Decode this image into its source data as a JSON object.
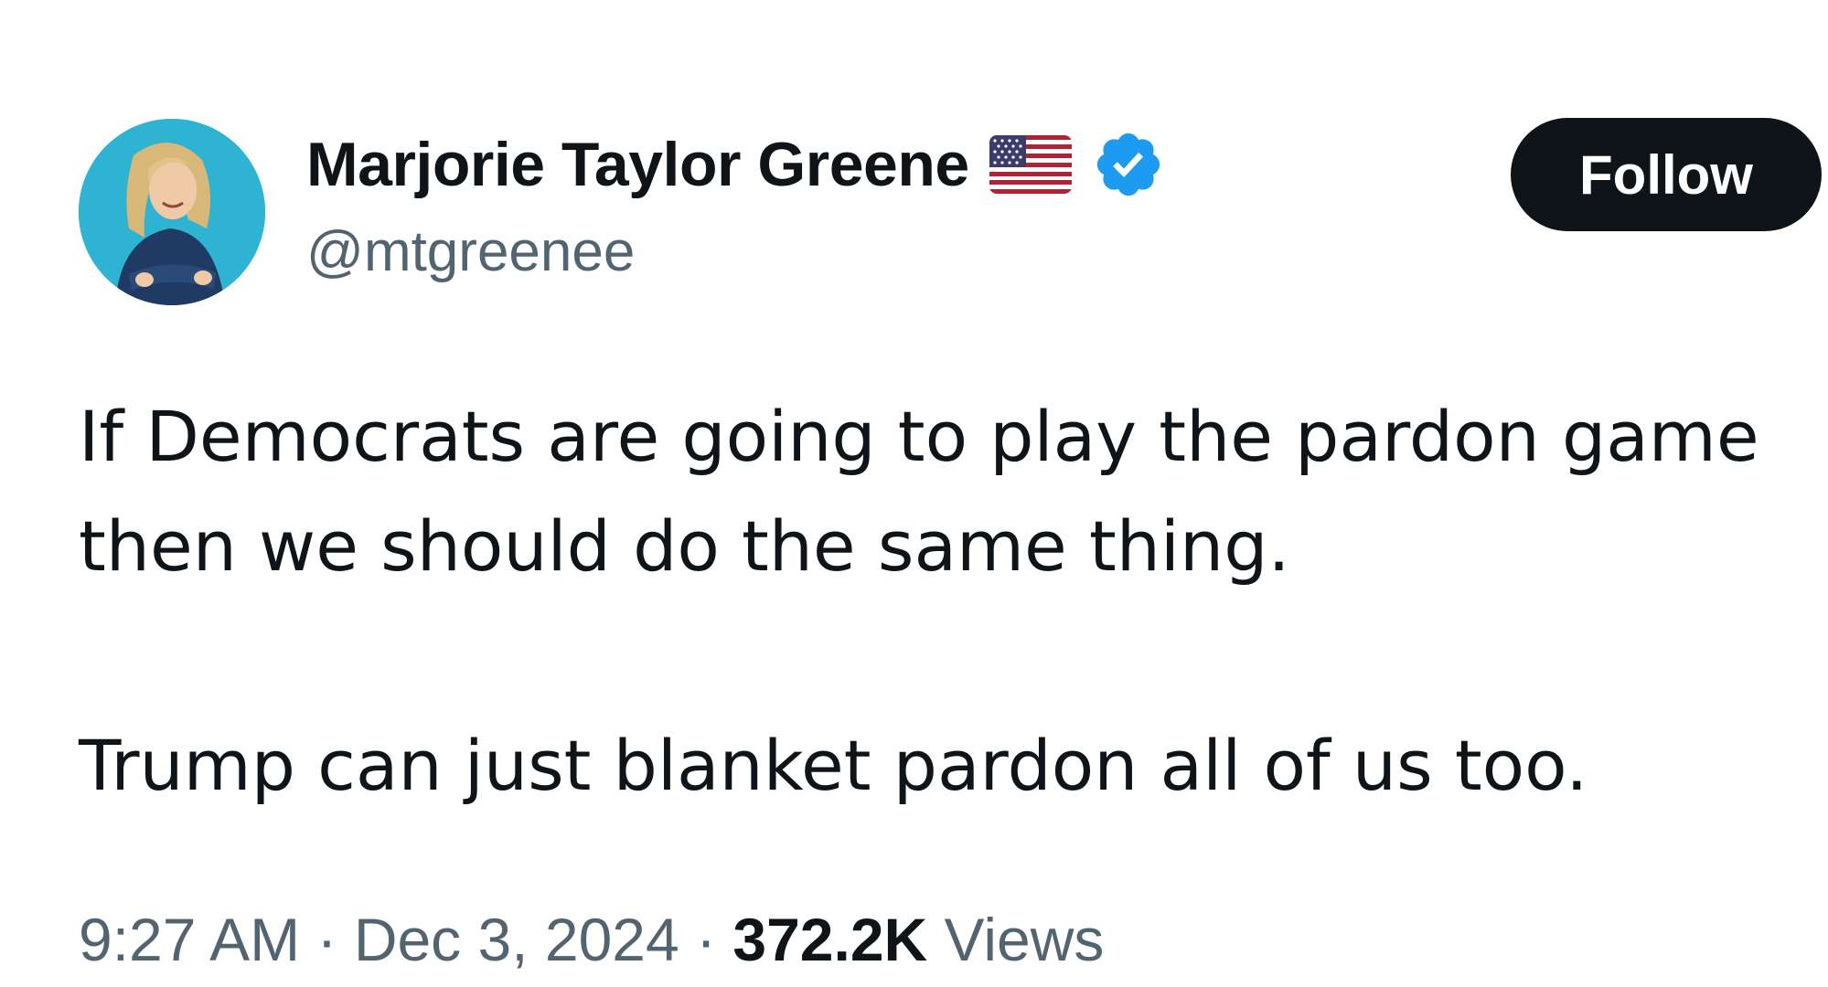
{
  "author": {
    "display_name": "Marjorie Taylor Greene",
    "handle": "@mtgreenee",
    "flag_icon": "us-flag-icon",
    "verified_icon": "verified-badge-icon",
    "verified_color": "#1d9bf0"
  },
  "follow_button": {
    "label": "Follow"
  },
  "tweet": {
    "line1": "If Democrats are going to play the pardon game",
    "line2": "then we should do the same thing.",
    "line3": "Trump can just blanket pardon all of us too."
  },
  "meta": {
    "time": "9:27 AM",
    "separator1": " · ",
    "date": "Dec 3, 2024",
    "separator2": " · ",
    "views_count": "372.2K",
    "views_label": " Views"
  },
  "colors": {
    "text_primary": "#0f1419",
    "text_secondary": "#536471",
    "button_bg": "#0f1419",
    "avatar_bg": "#2fb3d3"
  }
}
